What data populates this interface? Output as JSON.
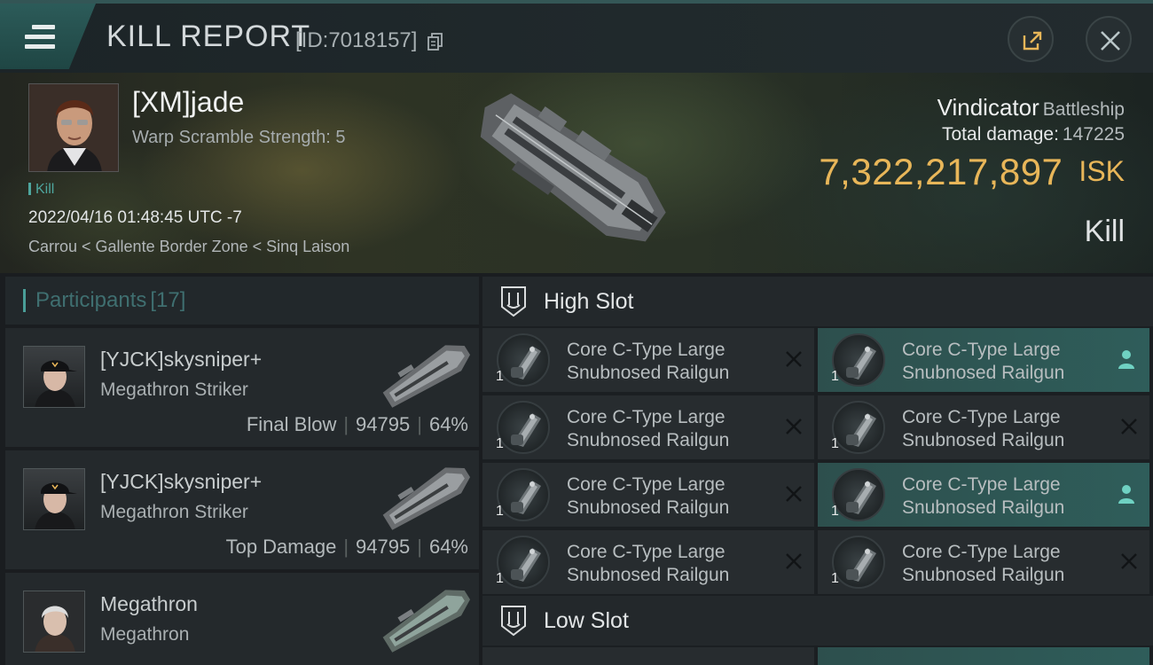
{
  "header": {
    "title": "KILL REPORT",
    "report_id": "[ID:7018157]"
  },
  "victim": {
    "name": "[XM]jade",
    "warp_scramble": "Warp Scramble Strength: 5",
    "kill_tag": "Kill",
    "datetime": "2022/04/16 01:48:45 UTC -7",
    "location": "Carrou < Gallente Border Zone < Sinq Laison",
    "ship_name": "Vindicator",
    "ship_class": "Battleship",
    "total_damage_label": "Total damage:",
    "total_damage": "147225",
    "isk_value": "7,322,217,897",
    "isk_unit": "ISK",
    "result": "Kill"
  },
  "participants": {
    "title": "Participants",
    "count": "[17]",
    "rows": [
      {
        "name": "[YJCK]skysniper+",
        "ship": "Megathron Striker",
        "label": "Final Blow",
        "damage": "94795",
        "percent": "64%"
      },
      {
        "name": "[YJCK]skysniper+",
        "ship": "Megathron Striker",
        "label": "Top Damage",
        "damage": "94795",
        "percent": "64%"
      },
      {
        "name": "Megathron",
        "ship": "Megathron"
      }
    ]
  },
  "fitting": {
    "high_slot_title": "High Slot",
    "low_slot_title": "Low Slot",
    "modules": [
      {
        "name_line1": "Core C-Type Large",
        "name_line2": "Snubnosed Railgun",
        "qty": "1",
        "status": "destroyed"
      },
      {
        "name_line1": "Core C-Type Large",
        "name_line2": "Snubnosed Railgun",
        "qty": "1",
        "status": "dropped"
      },
      {
        "name_line1": "Core C-Type Large",
        "name_line2": "Snubnosed Railgun",
        "qty": "1",
        "status": "destroyed"
      },
      {
        "name_line1": "Core C-Type Large",
        "name_line2": "Snubnosed Railgun",
        "qty": "1",
        "status": "destroyed"
      },
      {
        "name_line1": "Core C-Type Large",
        "name_line2": "Snubnosed Railgun",
        "qty": "1",
        "status": "destroyed"
      },
      {
        "name_line1": "Core C-Type Large",
        "name_line2": "Snubnosed Railgun",
        "qty": "1",
        "status": "dropped"
      },
      {
        "name_line1": "Core C-Type Large",
        "name_line2": "Snubnosed Railgun",
        "qty": "1",
        "status": "destroyed"
      },
      {
        "name_line1": "Core C-Type Large",
        "name_line2": "Snubnosed Railgun",
        "qty": "1",
        "status": "destroyed"
      }
    ]
  },
  "colors": {
    "accent_teal": "#4a9e98",
    "isk_gold": "#e8b659",
    "dropped_highlight": "#2f5d5a"
  },
  "icons": [
    "menu-icon",
    "copy-icon",
    "share-icon",
    "close-icon",
    "slot-icon",
    "railgun-icon",
    "destroyed-x-icon",
    "dropped-person-icon"
  ]
}
